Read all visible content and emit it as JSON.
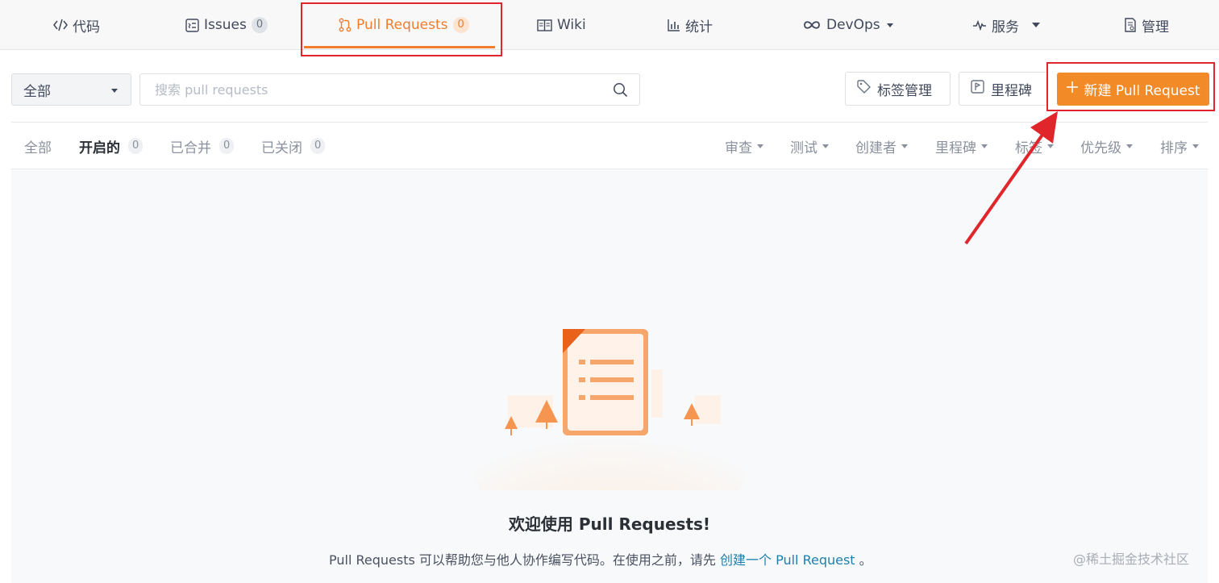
{
  "nav": {
    "tabs": [
      {
        "label": "代码",
        "icon": "code-icon"
      },
      {
        "label": "Issues",
        "count": "0",
        "icon": "issues-icon"
      },
      {
        "label": "Pull Requests",
        "count": "0",
        "icon": "pull-request-icon",
        "active": true
      },
      {
        "label": "Wiki",
        "icon": "book-icon"
      },
      {
        "label": "统计",
        "icon": "bar-chart-icon"
      },
      {
        "label": "DevOps",
        "icon": "infinity-icon",
        "dropdown": true
      },
      {
        "label": "服务",
        "icon": "pulse-icon",
        "dropdown": true
      },
      {
        "label": "管理",
        "icon": "settings-doc-icon"
      }
    ]
  },
  "toolbar": {
    "scope": "全部",
    "search_placeholder": "搜索 pull requests",
    "label_button": "标签管理",
    "milestone_button": "里程碑",
    "new_pr_button": "新建 Pull Request"
  },
  "filters": {
    "states": [
      {
        "label": "全部"
      },
      {
        "label": "开启的",
        "count": "0",
        "active": true
      },
      {
        "label": "已合并",
        "count": "0"
      },
      {
        "label": "已关闭",
        "count": "0"
      }
    ],
    "dropdowns": [
      "审查",
      "测试",
      "创建者",
      "里程碑",
      "标签",
      "优先级",
      "排序"
    ]
  },
  "empty_state": {
    "title": "欢迎使用 Pull Requests!",
    "desc_prefix": "Pull Requests 可以帮助您与他人协作编写代码。在使用之前，请先",
    "desc_link": "创建一个 Pull Request",
    "desc_suffix": "。"
  },
  "watermark": "@稀土掘金技术社区",
  "colors": {
    "accent": "#f27d2d",
    "primary_button": "#f28a27",
    "highlight_red": "#e0262b",
    "link": "#1c7fb0"
  }
}
